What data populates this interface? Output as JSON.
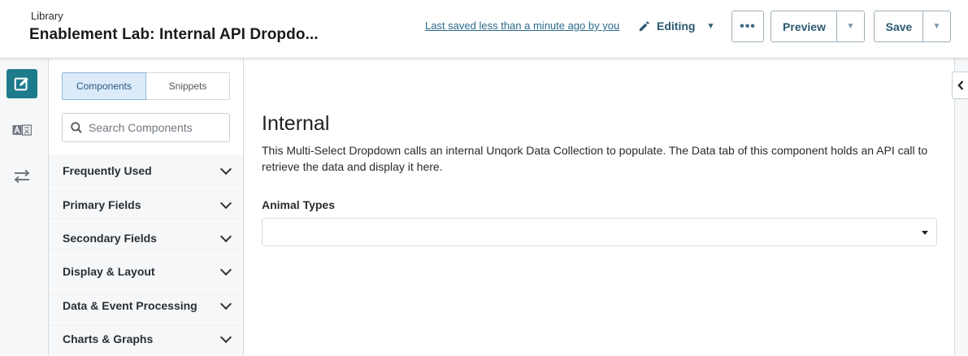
{
  "header": {
    "breadcrumb": "Library",
    "title": "Enablement Lab: Internal API Dropdo...",
    "saved_status": "Last saved less than a minute ago by you",
    "mode_label": "Editing",
    "more_label": "•••",
    "preview_label": "Preview",
    "save_label": "Save"
  },
  "rail": {
    "items": [
      {
        "icon": "edit-icon",
        "active": true
      },
      {
        "icon": "translate-icon",
        "active": false
      },
      {
        "icon": "swap-arrows-icon",
        "active": false
      }
    ]
  },
  "panel": {
    "tabs": [
      {
        "label": "Components",
        "selected": true
      },
      {
        "label": "Snippets",
        "selected": false
      }
    ],
    "search": {
      "placeholder": "Search Components",
      "value": ""
    },
    "categories": [
      {
        "label": "Frequently Used"
      },
      {
        "label": "Primary Fields"
      },
      {
        "label": "Secondary Fields"
      },
      {
        "label": "Display & Layout"
      },
      {
        "label": "Data & Event Processing"
      },
      {
        "label": "Charts & Graphs"
      }
    ]
  },
  "canvas": {
    "heading": "Internal",
    "description": "This Multi-Select Dropdown calls an internal Unqork Data Collection to populate. The Data tab of this component holds an API call to retrieve the data and display it here.",
    "field_label": "Animal Types",
    "field_value": ""
  },
  "colors": {
    "accent": "#1d7b8c",
    "link": "#2b6a8c",
    "panel_bg": "#f6f7f8"
  }
}
